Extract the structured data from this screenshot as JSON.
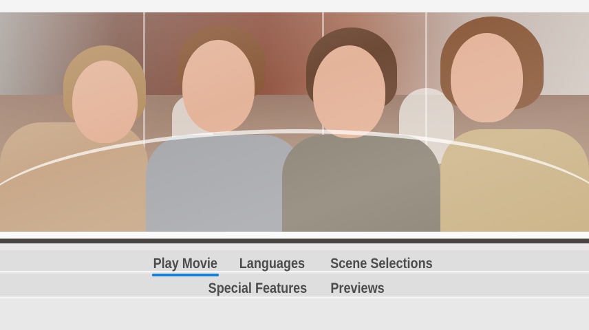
{
  "menu": {
    "row1": [
      {
        "label": "Play Movie",
        "selected": true
      },
      {
        "label": "Languages",
        "selected": false
      },
      {
        "label": "Scene Selections",
        "selected": false
      }
    ],
    "row2": [
      {
        "label": "Special Features",
        "selected": false
      },
      {
        "label": "Previews",
        "selected": false
      }
    ]
  },
  "colors": {
    "highlight": "#1a7fd8",
    "menu_text": "#4c4c4c",
    "menu_background": "#e8e8e8"
  }
}
